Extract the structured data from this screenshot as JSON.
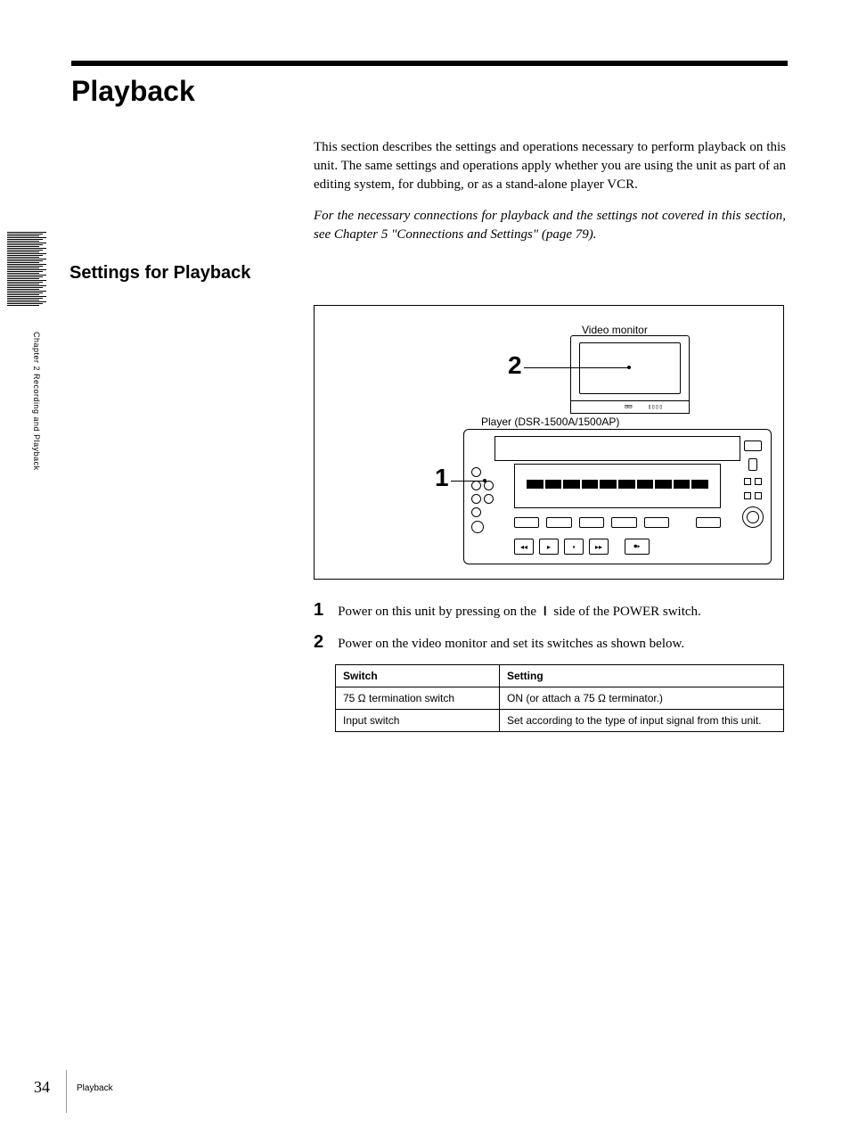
{
  "title": "Playback",
  "intro": "This section describes the settings and operations necessary to perform playback on this unit. The same settings and operations apply whether you are using the unit as part of an editing system, for dubbing, or as a stand-alone player VCR.",
  "intro_italic": "For the necessary connections for playback and the settings not covered in this section, see Chapter 5 \"Connections and Settings\" (page 79).",
  "subheading": "Settings for Playback",
  "vertical_label": "Chapter 2  Recording and Playback",
  "diagram": {
    "monitor_label": "Video monitor",
    "player_label": "Player (DSR-1500A/1500AP)",
    "callout1": "1",
    "callout2": "2"
  },
  "steps": [
    {
      "num": "1",
      "text_before": "Power on this unit by pressing on the ",
      "power_symbol": "⏽",
      "text_after": " side of the POWER switch."
    },
    {
      "num": "2",
      "text": "Power on the video monitor and set its switches as shown below."
    }
  ],
  "table": {
    "headers": [
      "Switch",
      "Setting"
    ],
    "rows": [
      [
        "75 Ω termination switch",
        "ON (or attach a 75 Ω terminator.)"
      ],
      [
        "Input switch",
        "Set according to the type of input signal from this unit."
      ]
    ]
  },
  "pagenum": "34",
  "footer_section": "Playback"
}
